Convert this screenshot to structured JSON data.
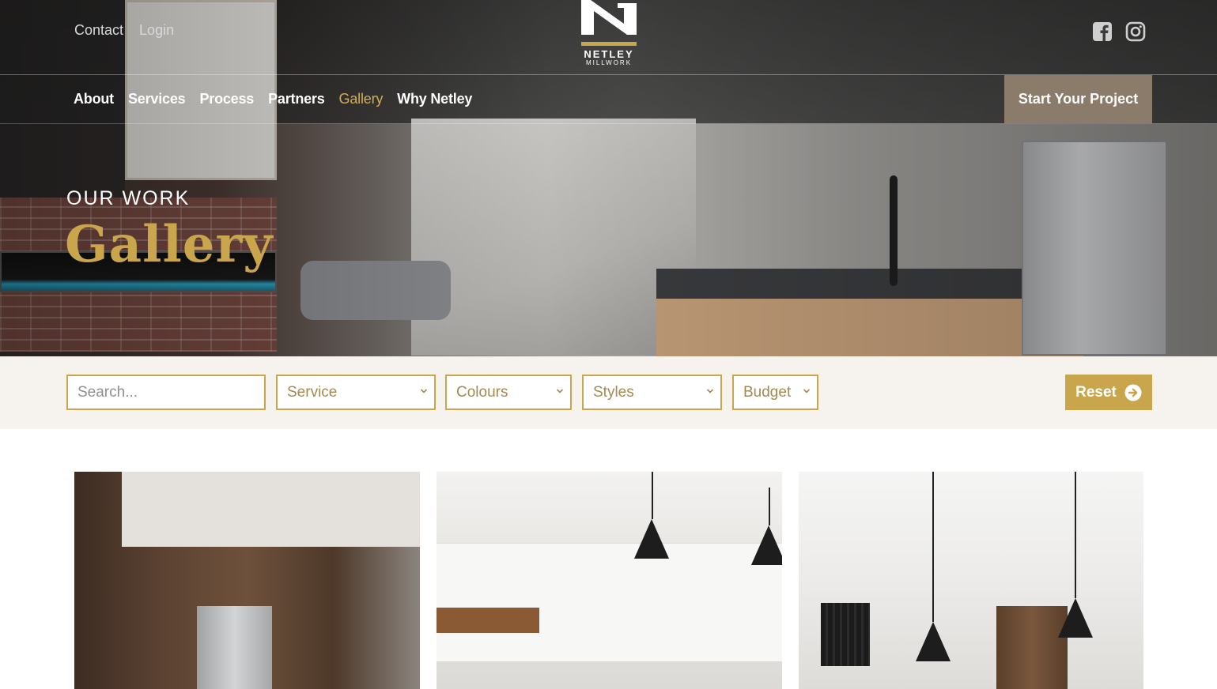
{
  "header": {
    "top_links": [
      "Contact",
      "Login"
    ],
    "logo": {
      "name": "NETLEY",
      "sub": "MILLWORK"
    },
    "social": [
      "facebook-icon",
      "instagram-icon"
    ]
  },
  "nav": {
    "items": [
      {
        "label": "About",
        "active": false
      },
      {
        "label": "Services",
        "active": false
      },
      {
        "label": "Process",
        "active": false
      },
      {
        "label": "Partners",
        "active": false
      },
      {
        "label": "Gallery",
        "active": true
      },
      {
        "label": "Why Netley",
        "active": false
      }
    ],
    "cta": "Start Your Project"
  },
  "hero": {
    "eyebrow": "OUR WORK",
    "title": "Gallery"
  },
  "filters": {
    "search_placeholder": "Search...",
    "service": "Service",
    "colours": "Colours",
    "styles": "Styles",
    "budget": "Budget",
    "reset": "Reset"
  },
  "colors": {
    "gold": "#c9a64c",
    "cta_bg": "#8b7b6a",
    "filter_bg": "#f6f3ef"
  }
}
